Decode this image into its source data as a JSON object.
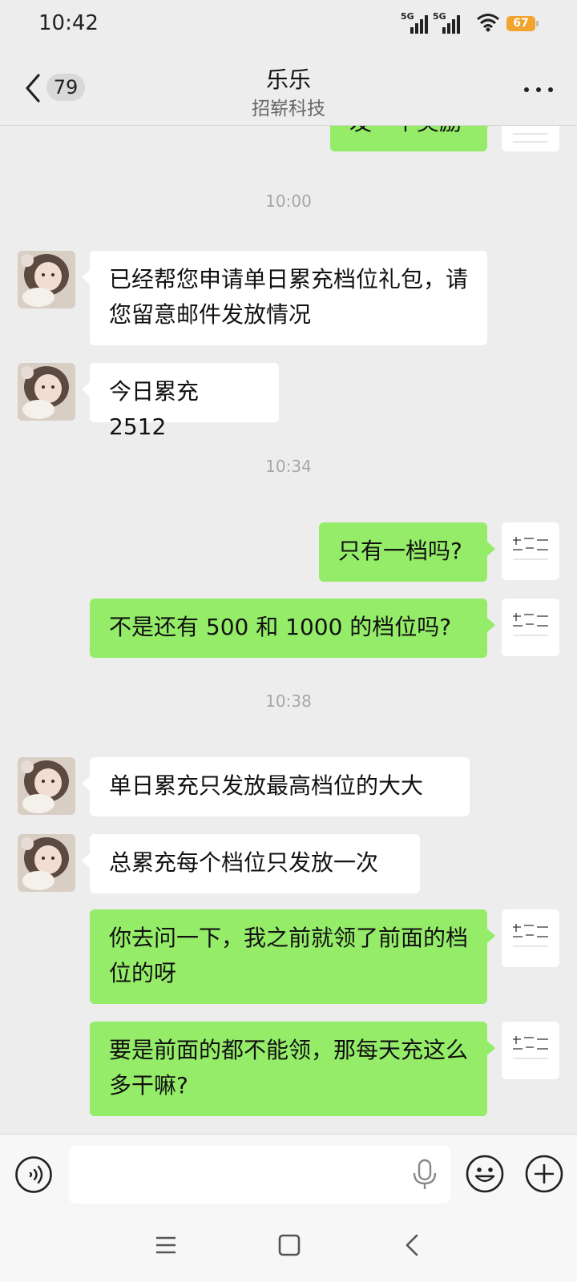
{
  "status_bar": {
    "time": "10:42",
    "signal_1_label": "5G",
    "signal_2_label": "5G",
    "battery": "67"
  },
  "header": {
    "unread_count": "79",
    "title": "乐乐",
    "subtitle": "招崭科技"
  },
  "chat": {
    "top_partial_text": "发一个奖励",
    "timestamps": [
      "10:00",
      "10:34",
      "10:38"
    ],
    "messages": [
      {
        "from": "other",
        "text": "已经帮您申请单日累充档位礼包，请您留意邮件发放情况"
      },
      {
        "from": "other",
        "text": "今日累充 2512"
      },
      {
        "from": "me",
        "text": "只有一档吗?"
      },
      {
        "from": "me",
        "text": "不是还有 500 和 1000 的档位吗?"
      },
      {
        "from": "other",
        "text": "单日累充只发放最高档位的大大"
      },
      {
        "from": "other",
        "text": "总累充每个档位只发放一次"
      },
      {
        "from": "me",
        "text": "你去问一下，我之前就领了前面的档位的呀"
      },
      {
        "from": "me",
        "text": "要是前面的都不能领，那每天充这么多干嘛?"
      }
    ]
  },
  "input": {
    "placeholder": ""
  },
  "icons": {
    "back": "chevron-left-icon",
    "more": "more-dots-icon",
    "voice": "voice-icon",
    "mic": "microphone-icon",
    "emoji": "emoji-icon",
    "plus": "plus-icon",
    "nav_menu": "menu-icon",
    "nav_home": "home-square-icon",
    "nav_back": "nav-back-icon"
  },
  "colors": {
    "outgoing_bubble": "#95ec69",
    "incoming_bubble": "#ffffff",
    "background": "#ededed",
    "battery": "#f3a42e"
  }
}
